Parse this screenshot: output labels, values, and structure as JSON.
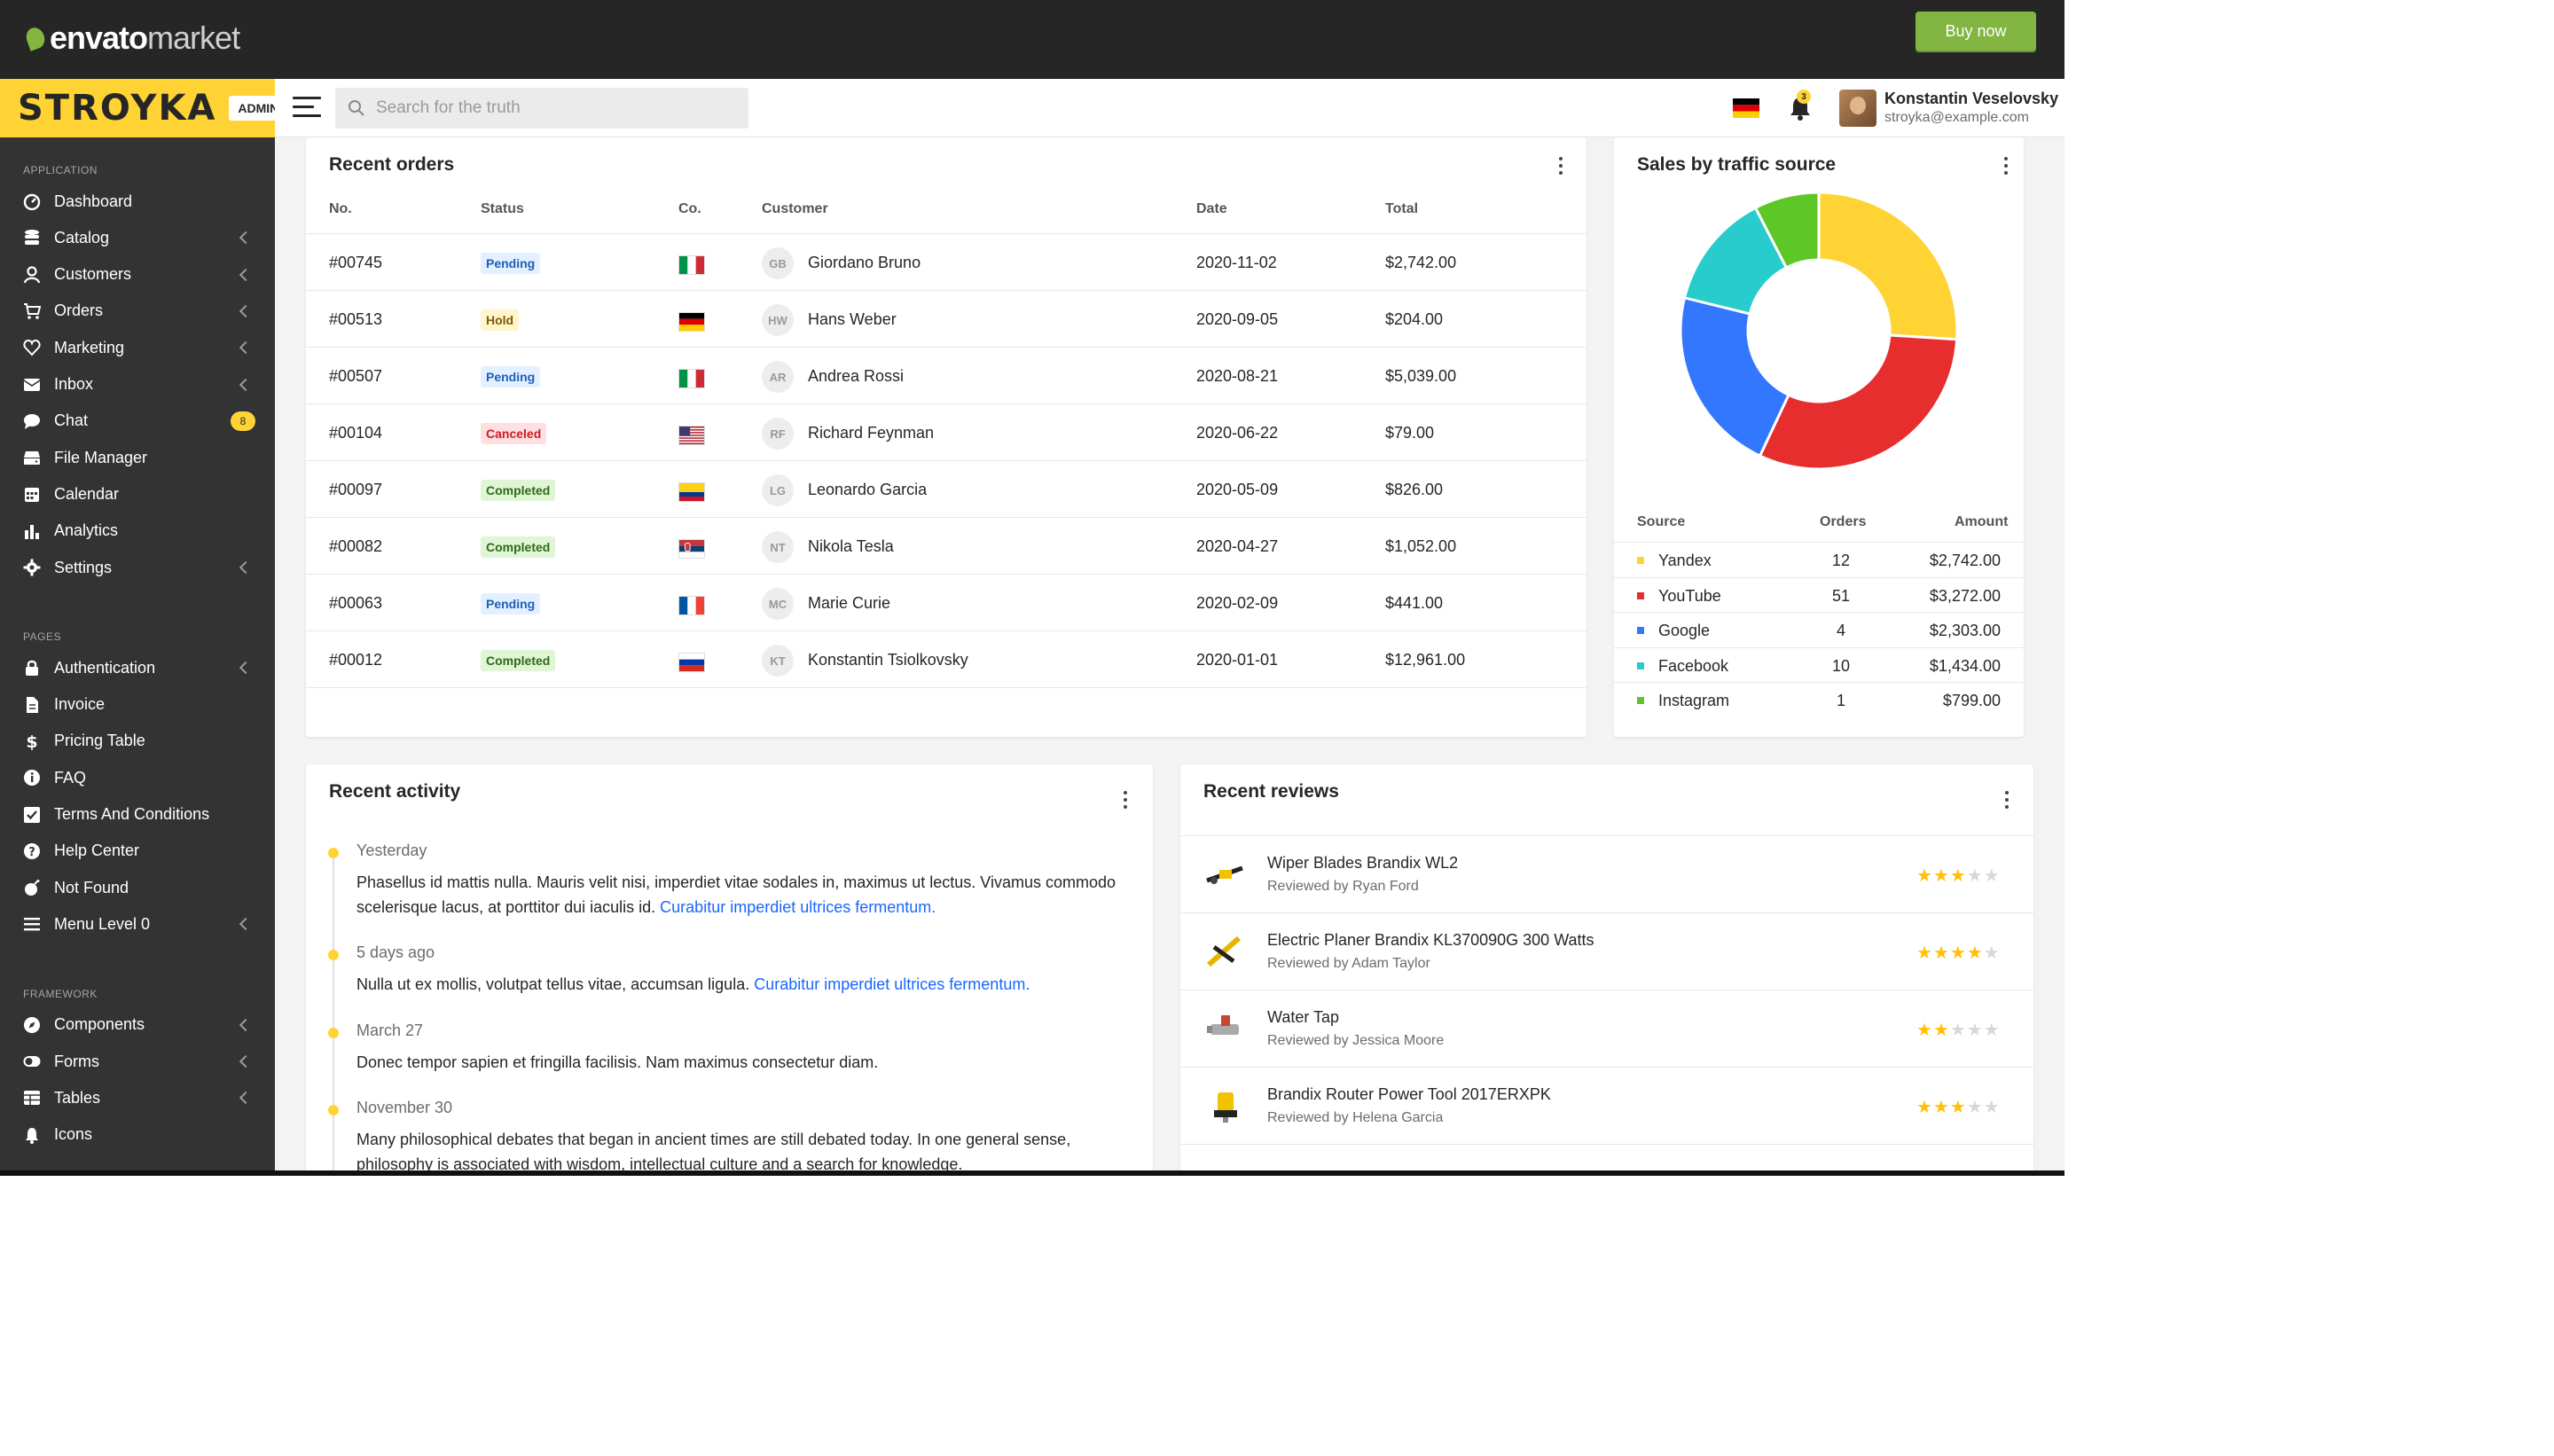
{
  "envato": {
    "logo_bold": "envato",
    "logo_light": "market",
    "buy_label": "Buy now",
    "accent": "#82b541"
  },
  "brand": {
    "name": "STROYKA",
    "badge": "ADMIN",
    "color": "#ffd333"
  },
  "topbar": {
    "search_placeholder": "Search for the truth",
    "notification_count": "3",
    "user_name": "Konstantin Veselovsky",
    "user_email": "stroyka@example.com"
  },
  "sidebar": {
    "sections": [
      {
        "title": "APPLICATION",
        "items": [
          {
            "label": "Dashboard",
            "icon": "dashboard-icon",
            "chevron": false
          },
          {
            "label": "Catalog",
            "icon": "database-icon",
            "chevron": true
          },
          {
            "label": "Customers",
            "icon": "user-icon",
            "chevron": true
          },
          {
            "label": "Orders",
            "icon": "cart-icon",
            "chevron": true
          },
          {
            "label": "Marketing",
            "icon": "heart-icon",
            "chevron": true
          },
          {
            "label": "Inbox",
            "icon": "envelope-icon",
            "chevron": true
          },
          {
            "label": "Chat",
            "icon": "chat-icon",
            "badge": "8"
          },
          {
            "label": "File Manager",
            "icon": "storage-icon",
            "chevron": false
          },
          {
            "label": "Calendar",
            "icon": "calendar-icon",
            "chevron": false
          },
          {
            "label": "Analytics",
            "icon": "bar-chart-icon",
            "chevron": false
          },
          {
            "label": "Settings",
            "icon": "gear-icon",
            "chevron": true
          }
        ]
      },
      {
        "title": "PAGES",
        "items": [
          {
            "label": "Authentication",
            "icon": "lock-icon",
            "chevron": true
          },
          {
            "label": "Invoice",
            "icon": "document-icon",
            "chevron": false
          },
          {
            "label": "Pricing Table",
            "icon": "dollar-icon",
            "chevron": false
          },
          {
            "label": "FAQ",
            "icon": "info-icon",
            "chevron": false
          },
          {
            "label": "Terms And Conditions",
            "icon": "checkbox-icon",
            "chevron": false
          },
          {
            "label": "Help Center",
            "icon": "question-icon",
            "chevron": false
          },
          {
            "label": "Not Found",
            "icon": "bomb-icon",
            "chevron": false
          },
          {
            "label": "Menu Level 0",
            "icon": "menu-icon",
            "chevron": true
          }
        ]
      },
      {
        "title": "FRAMEWORK",
        "items": [
          {
            "label": "Components",
            "icon": "compass-icon",
            "chevron": true
          },
          {
            "label": "Forms",
            "icon": "toggle-icon",
            "chevron": true
          },
          {
            "label": "Tables",
            "icon": "table-icon",
            "chevron": true
          },
          {
            "label": "Icons",
            "icon": "bell-icon",
            "chevron": false
          }
        ]
      }
    ]
  },
  "recent_orders": {
    "title": "Recent orders",
    "columns": [
      "No.",
      "Status",
      "Co.",
      "Customer",
      "Date",
      "Total"
    ],
    "rows": [
      {
        "no": "#00745",
        "status": "Pending",
        "country": "it",
        "initials": "GB",
        "customer": "Giordano Bruno",
        "date": "2020-11-02",
        "total": "$2,742.00"
      },
      {
        "no": "#00513",
        "status": "Hold",
        "country": "de",
        "initials": "HW",
        "customer": "Hans Weber",
        "date": "2020-09-05",
        "total": "$204.00"
      },
      {
        "no": "#00507",
        "status": "Pending",
        "country": "it",
        "initials": "AR",
        "customer": "Andrea Rossi",
        "date": "2020-08-21",
        "total": "$5,039.00"
      },
      {
        "no": "#00104",
        "status": "Canceled",
        "country": "us",
        "initials": "RF",
        "customer": "Richard Feynman",
        "date": "2020-06-22",
        "total": "$79.00"
      },
      {
        "no": "#00097",
        "status": "Completed",
        "country": "co",
        "initials": "LG",
        "customer": "Leonardo Garcia",
        "date": "2020-05-09",
        "total": "$826.00"
      },
      {
        "no": "#00082",
        "status": "Completed",
        "country": "rs",
        "initials": "NT",
        "customer": "Nikola Tesla",
        "date": "2020-04-27",
        "total": "$1,052.00"
      },
      {
        "no": "#00063",
        "status": "Pending",
        "country": "fr",
        "initials": "MC",
        "customer": "Marie Curie",
        "date": "2020-02-09",
        "total": "$441.00"
      },
      {
        "no": "#00012",
        "status": "Completed",
        "country": "ru",
        "initials": "KT",
        "customer": "Konstantin Tsiolkovsky",
        "date": "2020-01-01",
        "total": "$12,961.00"
      }
    ],
    "status_colors": {
      "Pending": {
        "bg": "#e3f0ff",
        "fg": "#1f5fb8"
      },
      "Hold": {
        "bg": "#fff4cc",
        "fg": "#7a5c00"
      },
      "Canceled": {
        "bg": "#ffdfe0",
        "fg": "#c81e24"
      },
      "Completed": {
        "bg": "#dff5d5",
        "fg": "#2e6b17"
      }
    }
  },
  "traffic": {
    "title": "Sales by traffic source",
    "columns": [
      "Source",
      "Orders",
      "Amount"
    ],
    "rows": [
      {
        "source": "Yandex",
        "orders": "12",
        "amount": "$2,742.00",
        "color": "#ffd333"
      },
      {
        "source": "YouTube",
        "orders": "51",
        "amount": "$3,272.00",
        "color": "#e62e2e"
      },
      {
        "source": "Google",
        "orders": "4",
        "amount": "$2,303.00",
        "color": "#3377ff"
      },
      {
        "source": "Facebook",
        "orders": "10",
        "amount": "$1,434.00",
        "color": "#29cccc"
      },
      {
        "source": "Instagram",
        "orders": "1",
        "amount": "$799.00",
        "color": "#5dc728"
      }
    ]
  },
  "chart_data": {
    "type": "pie",
    "categories": [
      "Yandex",
      "YouTube",
      "Google",
      "Facebook",
      "Instagram"
    ],
    "values": [
      2742,
      3272,
      2303,
      1434,
      799
    ],
    "colors": [
      "#ffd333",
      "#e62e2e",
      "#3377ff",
      "#29cccc",
      "#5dc728"
    ],
    "donut": true
  },
  "activity": {
    "title": "Recent activity",
    "items": [
      {
        "date": "Yesterday",
        "text": "Phasellus id mattis nulla. Mauris velit nisi, imperdiet vitae sodales in, maximus ut lectus. Vivamus commodo scelerisque lacus, at porttitor dui iaculis id. ",
        "link": "Curabitur imperdiet ultrices fermentum."
      },
      {
        "date": "5 days ago",
        "text": "Nulla ut ex mollis, volutpat tellus vitae, accumsan ligula. ",
        "link": "Curabitur imperdiet ultrices fermentum."
      },
      {
        "date": "March 27",
        "text": "Donec tempor sapien et fringilla facilisis. Nam maximus consectetur diam.",
        "link": ""
      },
      {
        "date": "November 30",
        "text": "Many philosophical debates that began in ancient times are still debated today. In one general sense, philosophy is associated with wisdom, intellectual culture and a search for knowledge.",
        "link": ""
      }
    ]
  },
  "reviews": {
    "title": "Recent reviews",
    "by_prefix": "Reviewed by",
    "items": [
      {
        "product": "Wiper Blades Brandix WL2",
        "reviewer": "Ryan Ford",
        "rating": 3,
        "thumb": "wiper-product-icon"
      },
      {
        "product": "Electric Planer Brandix KL370090G 300 Watts",
        "reviewer": "Adam Taylor",
        "rating": 4,
        "thumb": "planer-product-icon"
      },
      {
        "product": "Water Tap",
        "reviewer": "Jessica Moore",
        "rating": 2,
        "thumb": "tap-product-icon"
      },
      {
        "product": "Brandix Router Power Tool 2017ERXPK",
        "reviewer": "Helena Garcia",
        "rating": 3,
        "thumb": "router-product-icon"
      }
    ]
  }
}
